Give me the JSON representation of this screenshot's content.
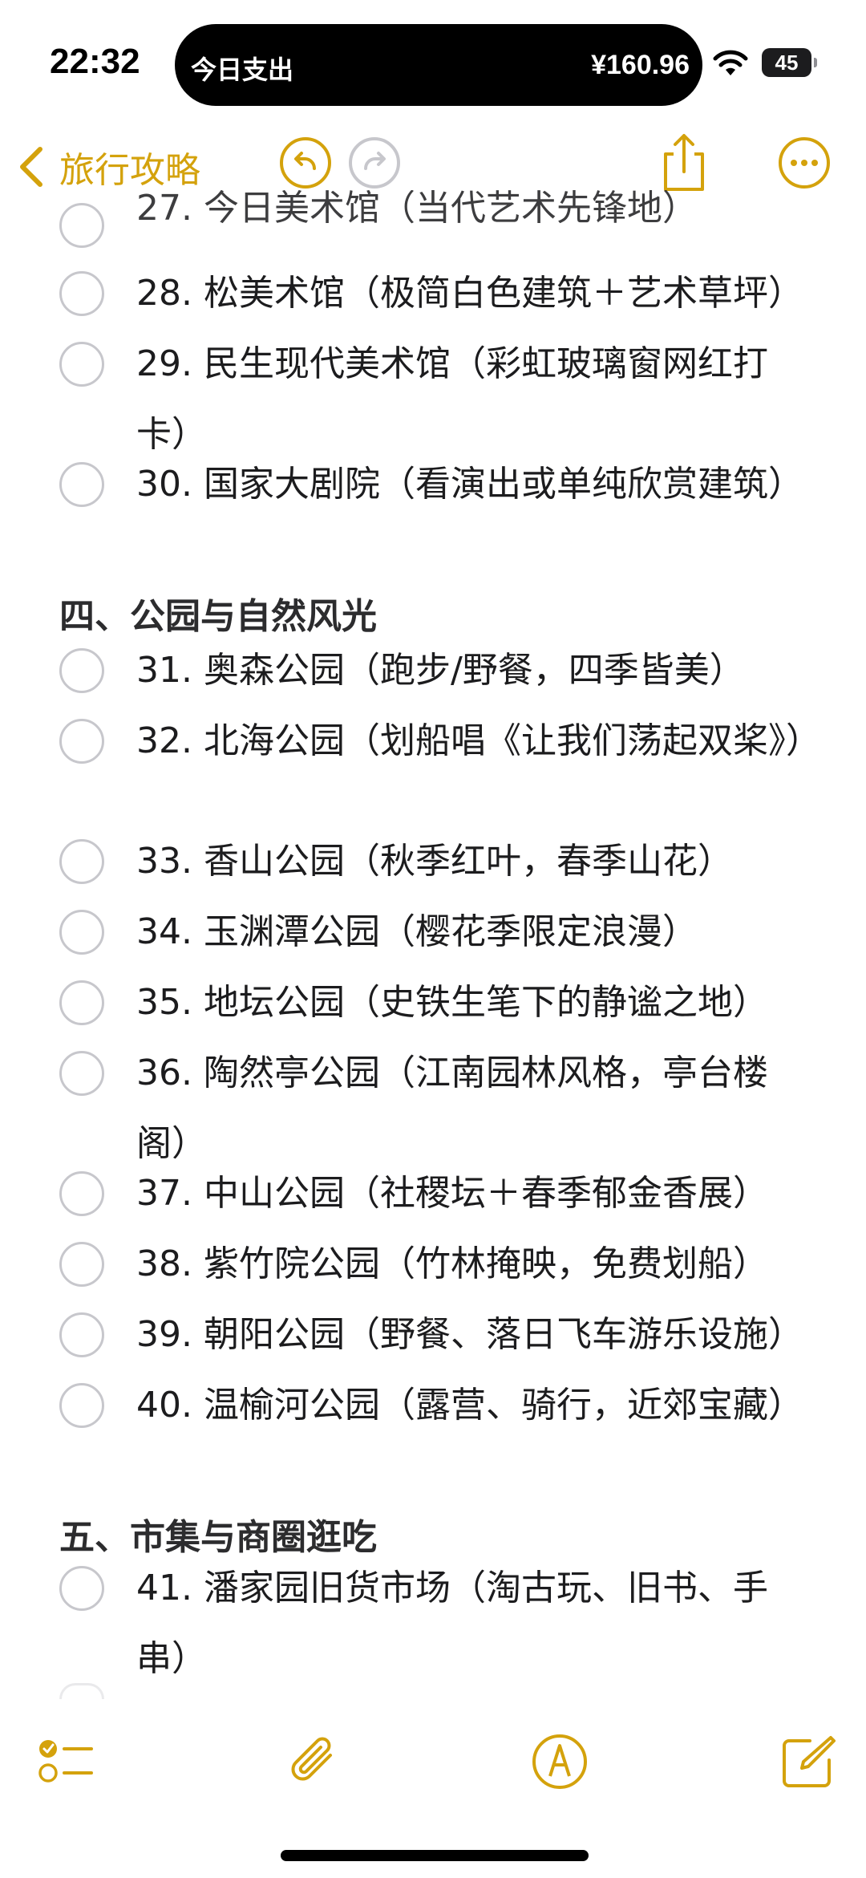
{
  "status_bar": {
    "time": "22:32",
    "battery": "45"
  },
  "live_activity": {
    "label": "今日支出",
    "amount": "¥160.96"
  },
  "nav": {
    "back_label": "旅行攻略"
  },
  "items": [
    {
      "label": "27. 今日美术馆（当代艺术先锋地）"
    },
    {
      "label": "28. 松美术馆（极简白色建筑＋艺术草坪）"
    },
    {
      "label": "29. 民生现代美术馆（彩虹玻璃窗网红打卡）"
    },
    {
      "label": "30. 国家大剧院（看演出或单纯欣赏建筑）"
    }
  ],
  "section_4": {
    "title": "四、公园与自然风光",
    "items": [
      {
        "label": "31. 奥森公园（跑步/野餐，四季皆美）"
      },
      {
        "label": "32. 北海公园（划船唱《让我们荡起双桨》）"
      },
      {
        "label": "33. 香山公园（秋季红叶，春季山花）"
      },
      {
        "label": "34. 玉渊潭公园（樱花季限定浪漫）"
      },
      {
        "label": "35. 地坛公园（史铁生笔下的静谧之地）"
      },
      {
        "label": "36. 陶然亭公园（江南园林风格，亭台楼阁）"
      },
      {
        "label": "37. 中山公园（社稷坛＋春季郁金香展）"
      },
      {
        "label": "38. 紫竹院公园（竹林掩映，免费划船）"
      },
      {
        "label": "39. 朝阳公园（野餐、落日飞车游乐设施）"
      },
      {
        "label": "40. 温榆河公园（露营、骑行，近郊宝藏）"
      }
    ]
  },
  "section_5": {
    "title": "五、市集与商圈逛吃",
    "items": [
      {
        "label": "41. 潘家园旧货市场（淘古玩、旧书、手串）"
      }
    ]
  },
  "toolbar_icons": [
    "checklist-icon",
    "attachment-icon",
    "markup-icon",
    "compose-icon"
  ],
  "colors": {
    "accent": "#d4a20c",
    "checkbox": "#c7c7cc",
    "text": "#1c1c1e"
  }
}
